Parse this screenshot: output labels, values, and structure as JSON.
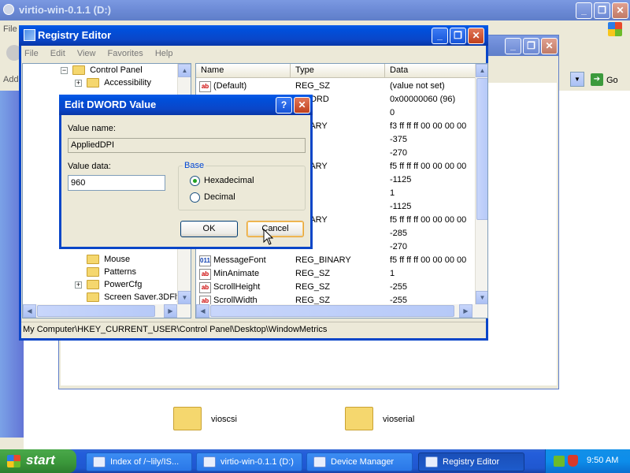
{
  "bg_window": {
    "title": "virtio-win-0.1.1 (D:)",
    "menu_first_letter": "File",
    "address_label": "Addr",
    "go_label": "Go",
    "files": [
      {
        "name": "vioscsi"
      },
      {
        "name": "vioserial"
      }
    ]
  },
  "regedit": {
    "title": "Registry Editor",
    "menu": [
      "File",
      "Edit",
      "View",
      "Favorites",
      "Help"
    ],
    "tree": [
      {
        "label": "Control Panel",
        "expander": "−",
        "indent": 0
      },
      {
        "label": "Accessibility",
        "expander": "+",
        "indent": 1
      },
      {
        "label": "Mouse",
        "expander": "",
        "indent": 1
      },
      {
        "label": "Patterns",
        "expander": "",
        "indent": 1
      },
      {
        "label": "PowerCfg",
        "expander": "+",
        "indent": 1
      },
      {
        "label": "Screen Saver.3DFly",
        "expander": "",
        "indent": 1
      }
    ],
    "columns": [
      "Name",
      "Type",
      "Data"
    ],
    "rows": [
      {
        "name": "(Default)",
        "type": "REG_SZ",
        "data": "(value not set)",
        "icon": "ab"
      },
      {
        "name": "",
        "type": "DWORD",
        "data": "0x00000060 (96)",
        "icon": ""
      },
      {
        "name": "",
        "type": "SZ",
        "data": "0",
        "icon": ""
      },
      {
        "name": "",
        "type": "BINARY",
        "data": "f3 ff ff ff 00 00 00 00",
        "icon": ""
      },
      {
        "name": "",
        "type": "SZ",
        "data": "-375",
        "icon": ""
      },
      {
        "name": "",
        "type": "SZ",
        "data": "-270",
        "icon": ""
      },
      {
        "name": "",
        "type": "BINARY",
        "data": "f5 ff ff ff 00 00 00 00",
        "icon": ""
      },
      {
        "name": "",
        "type": "SZ",
        "data": "-1125",
        "icon": ""
      },
      {
        "name": "",
        "type": "SZ",
        "data": "1",
        "icon": ""
      },
      {
        "name": "",
        "type": "SZ",
        "data": "-1125",
        "icon": ""
      },
      {
        "name": "",
        "type": "BINARY",
        "data": "f5 ff ff ff 00 00 00 00",
        "icon": ""
      },
      {
        "name": "",
        "type": "SZ",
        "data": "-285",
        "icon": ""
      },
      {
        "name": "",
        "type": "SZ",
        "data": "-270",
        "icon": ""
      },
      {
        "name": "MessageFont",
        "type": "REG_BINARY",
        "data": "f5 ff ff ff 00 00 00 00",
        "icon": "bin"
      },
      {
        "name": "MinAnimate",
        "type": "REG_SZ",
        "data": "1",
        "icon": "ab"
      },
      {
        "name": "ScrollHeight",
        "type": "REG_SZ",
        "data": "-255",
        "icon": "ab"
      },
      {
        "name": "ScrollWidth",
        "type": "REG_SZ",
        "data": "-255",
        "icon": "ab"
      }
    ],
    "status": "My Computer\\HKEY_CURRENT_USER\\Control Panel\\Desktop\\WindowMetrics"
  },
  "dialog": {
    "title": "Edit DWORD Value",
    "value_name_label": "Value name:",
    "value_name": "AppliedDPI",
    "value_data_label": "Value data:",
    "value_data": "960",
    "base_label": "Base",
    "hex_label": "Hexadecimal",
    "dec_label": "Decimal",
    "selected_base": "Hexadecimal",
    "ok_label": "OK",
    "cancel_label": "Cancel",
    "help_glyph": "?",
    "close_glyph": "✕"
  },
  "taskbar": {
    "start_label": "start",
    "tasks": [
      {
        "label": "Index of /~lily/IS..."
      },
      {
        "label": "virtio-win-0.1.1 (D:)"
      },
      {
        "label": "Device Manager"
      },
      {
        "label": "Registry Editor"
      }
    ],
    "clock": "9:50 AM"
  },
  "colors": {
    "title_active": "#0a5ce8",
    "taskbar": "#245edb",
    "start": "#3c9a3c"
  }
}
